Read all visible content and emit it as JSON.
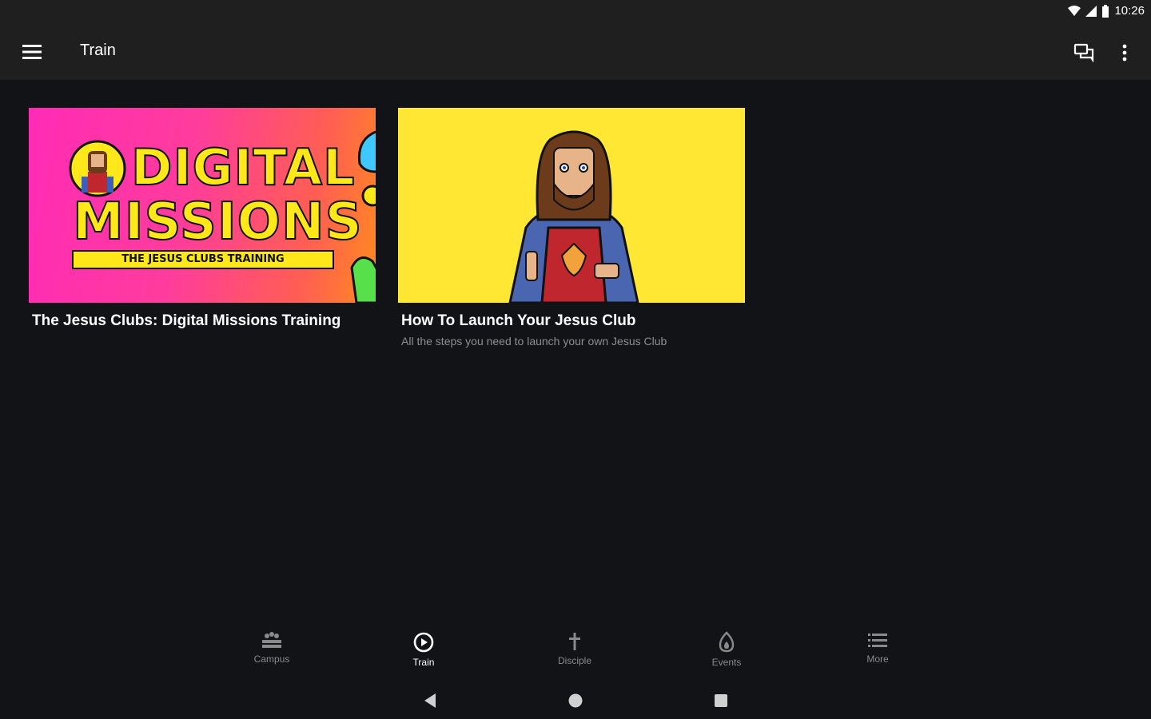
{
  "status_bar": {
    "time": "10:26"
  },
  "app_bar": {
    "title": "Train"
  },
  "cards": [
    {
      "title": "The Jesus Clubs: Digital Missions Training",
      "subtitle": "",
      "thumb_line1": "DIGITAL",
      "thumb_line2": "MISSIONS",
      "thumb_banner": "THE JESUS CLUBS TRAINING"
    },
    {
      "title": "How To Launch Your Jesus Club",
      "subtitle": "All the steps you need to launch your own Jesus Club"
    }
  ],
  "bottom_nav": [
    {
      "label": "Campus",
      "icon": "campus-icon",
      "active": false
    },
    {
      "label": "Train",
      "icon": "play-circle-icon",
      "active": true
    },
    {
      "label": "Disciple",
      "icon": "cross-icon",
      "active": false
    },
    {
      "label": "Events",
      "icon": "flame-icon",
      "active": false
    },
    {
      "label": "More",
      "icon": "list-icon",
      "active": false
    }
  ],
  "colors": {
    "app_bar": "#1f1f1f",
    "background": "#121316",
    "accent_yellow": "#ffe81a",
    "pink": "#ff2bb6"
  }
}
